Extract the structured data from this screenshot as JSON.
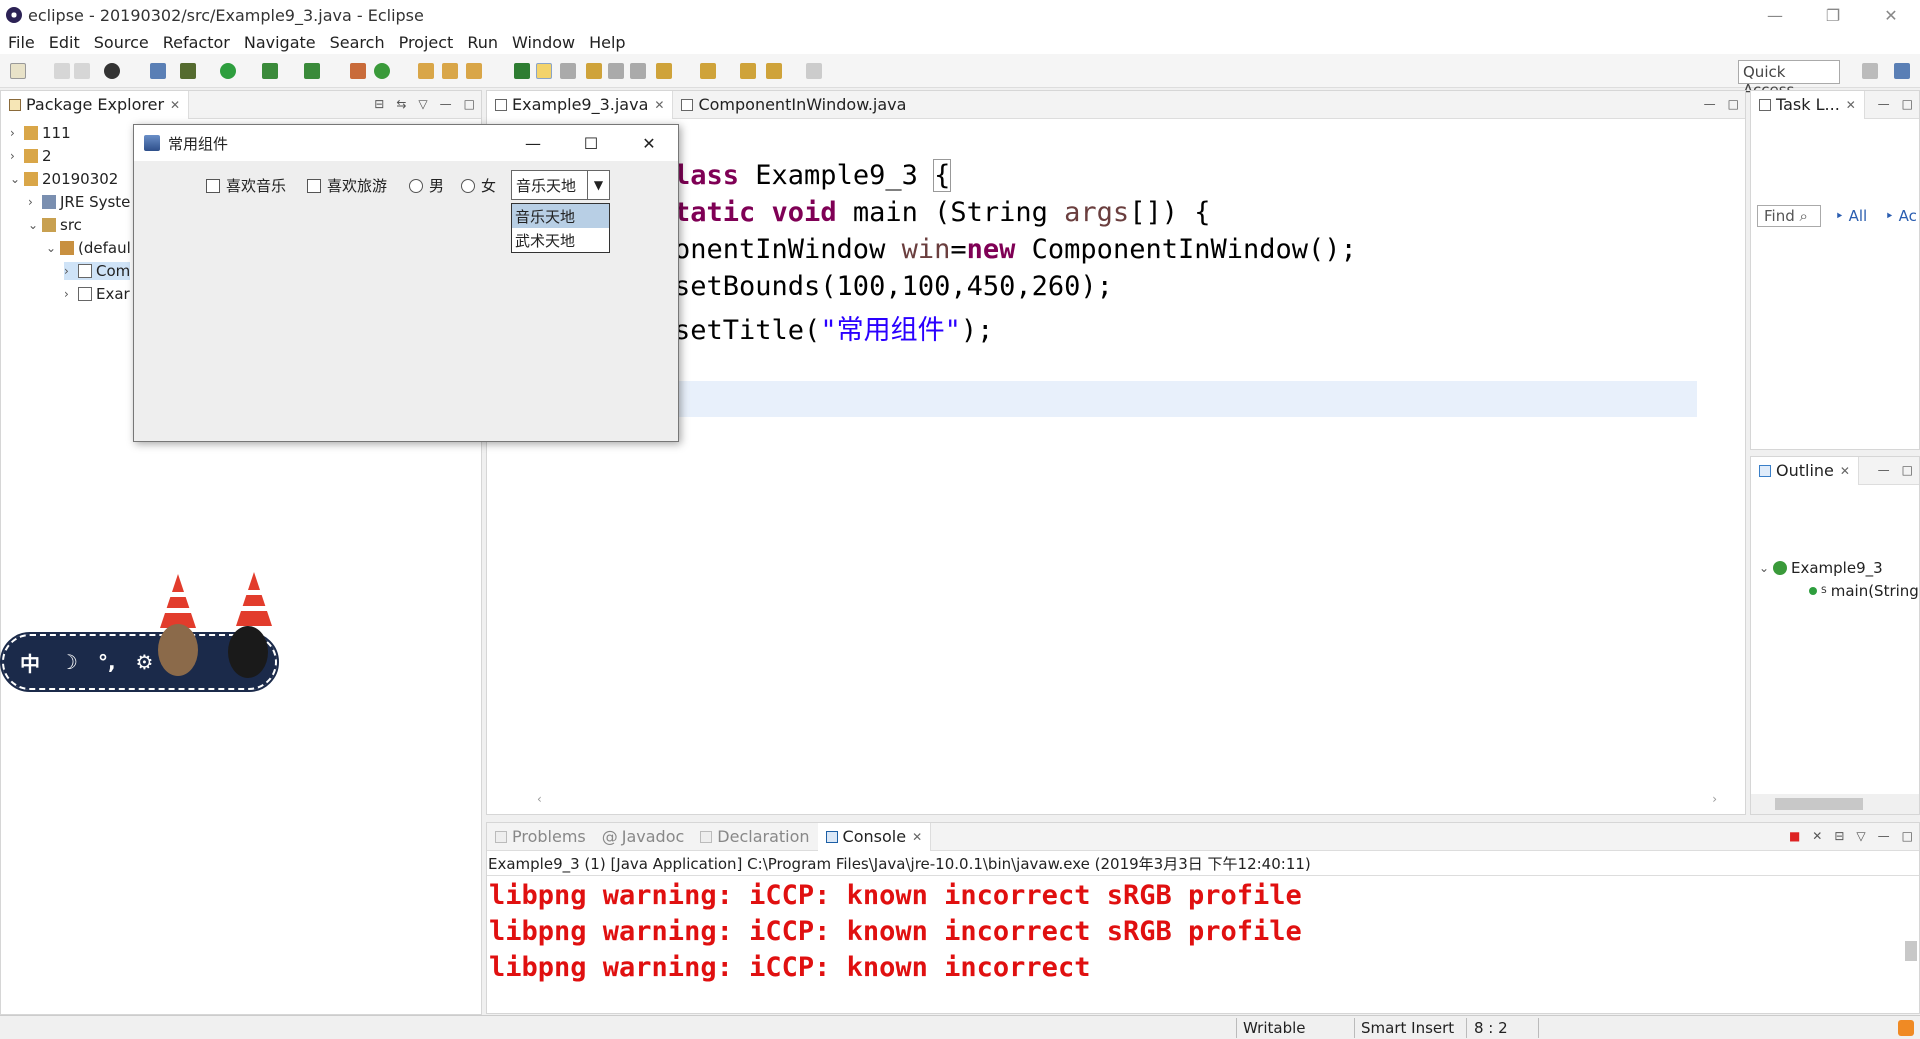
{
  "window": {
    "title": "eclipse - 20190302/src/Example9_3.java - Eclipse"
  },
  "menu": [
    "File",
    "Edit",
    "Source",
    "Refactor",
    "Navigate",
    "Search",
    "Project",
    "Run",
    "Window",
    "Help"
  ],
  "toolbar": {
    "quick_access": "Quick Access"
  },
  "package_explorer": {
    "tab": "Package Explorer",
    "items": [
      "111",
      "2",
      "20190302",
      "JRE Syste",
      "src",
      "(defaul",
      "Com",
      "Exar"
    ]
  },
  "editor": {
    "tabs": [
      "Example9_3.java",
      "ComponentInWindow.java"
    ],
    "lines": [
      {
        "kw1": "lass",
        "rest": " Example9_3 ",
        "brace": "{"
      },
      {
        "kw1": "tatic",
        "kw2": "void",
        "rest": " main (String ",
        "var": "args",
        "tail": "[]) {"
      },
      {
        "rest": "onentInWindow ",
        "var": "win",
        "eq": "=",
        "kw": "new",
        "tail": " ComponentInWindow();"
      },
      {
        "rest": "setBounds(100,100,450,260);"
      },
      {
        "rest": "setTitle(",
        "str": "\"常用组件\"",
        "tail": ");"
      }
    ]
  },
  "task_list": {
    "tab": "Task L...",
    "find": "Find",
    "all": "All",
    "ac": "Ac"
  },
  "outline": {
    "tab": "Outline",
    "class": "Example9_3",
    "method": "main(String"
  },
  "swing_window": {
    "title": "常用组件",
    "checkbox1": "喜欢音乐",
    "checkbox2": "喜欢旅游",
    "radio1": "男",
    "radio2": "女",
    "combo_value": "音乐天地",
    "options": [
      "音乐天地",
      "武术天地"
    ]
  },
  "ime": {
    "mode": "中"
  },
  "bottom": {
    "tabs": [
      "Problems",
      "Javadoc",
      "Declaration",
      "Console"
    ],
    "launch": "Example9_3 (1) [Java Application] C:\\Program Files\\Java\\jre-10.0.1\\bin\\javaw.exe (2019年3月3日 下午12:40:11)",
    "lines": [
      "libpng warning: iCCP: known incorrect sRGB profile",
      "libpng warning: iCCP: known incorrect sRGB profile",
      "libpng warning: iCCP: known incorrect"
    ]
  },
  "status": {
    "writable": "Writable",
    "insert": "Smart Insert",
    "pos": "8 : 2"
  }
}
